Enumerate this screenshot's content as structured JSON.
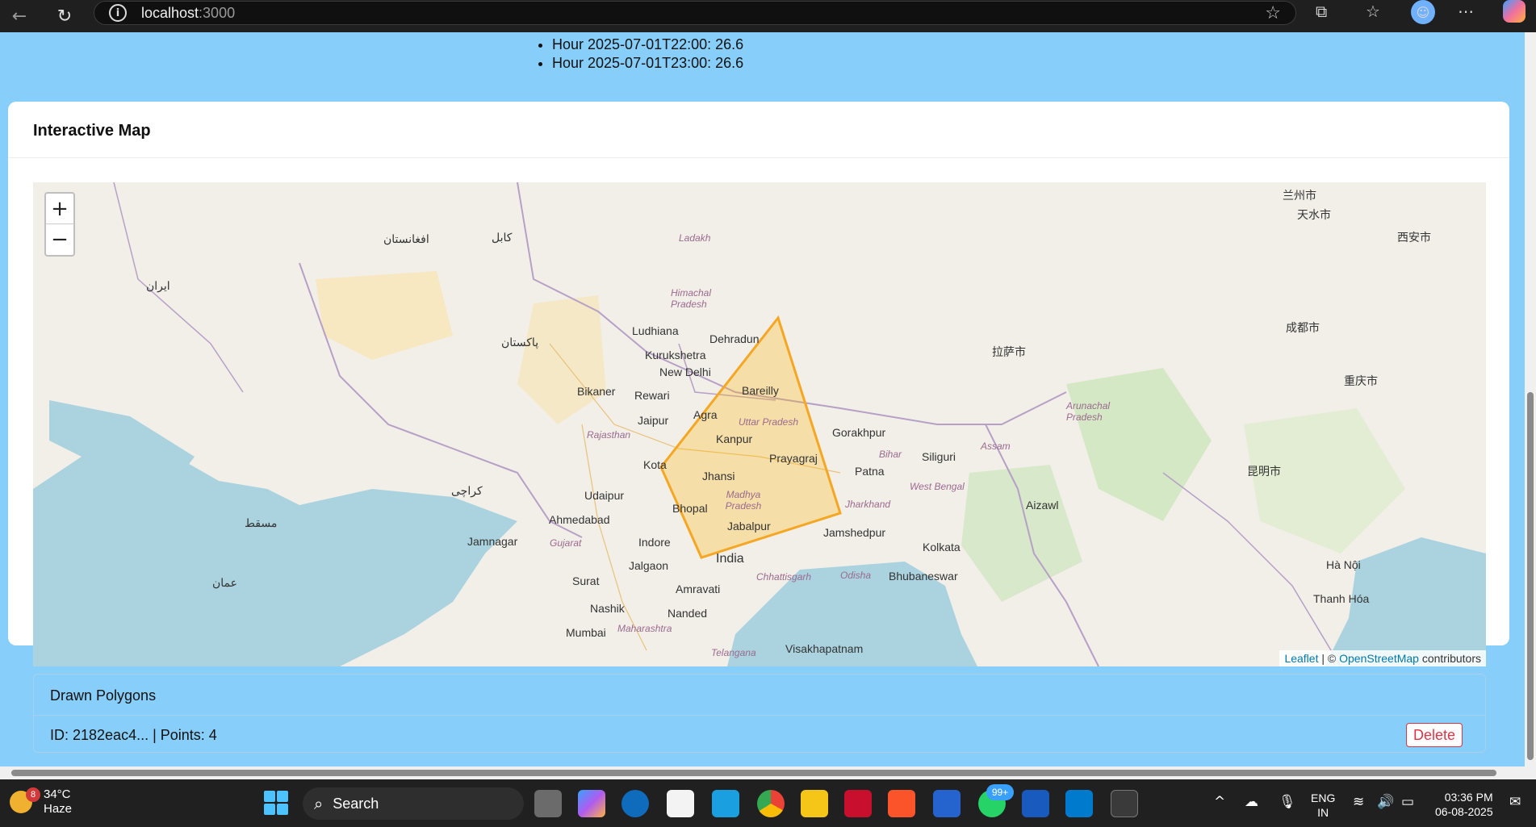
{
  "browser": {
    "back_icon": "arrow-left-icon",
    "refresh_icon": "refresh-icon",
    "url_host": "localhost",
    "url_port": ":3000"
  },
  "hourly": {
    "items": [
      "Hour 2025-07-01T22:00: 26.6",
      "Hour 2025-07-01T23:00: 26.6"
    ]
  },
  "map_card": {
    "title": "Interactive Map",
    "zoom_in": "+",
    "zoom_out": "−",
    "labels": {
      "kabul": "کابل",
      "afghanistan": "افغانستان",
      "iran": "ایران",
      "pakistan": "پاکستان",
      "ludhiana": "Ludhiana",
      "dehradun": "Dehradun",
      "kurukshetra": "Kurukshetra",
      "newdelhi": "New Delhi",
      "bikaner": "Bikaner",
      "rewari": "Rewari",
      "jaipur": "Jaipur",
      "agra": "Agra",
      "bareilly": "Bareilly",
      "kanpur": "Kanpur",
      "prayagraj": "Prayagraj",
      "jhansi": "Jhansi",
      "kota": "Kota",
      "udaipur": "Udaipur",
      "ahmedabad": "Ahmedabad",
      "bhopal": "Bhopal",
      "indore": "Indore",
      "jabalpur": "Jabalpur",
      "jamnagar": "Jamnagar",
      "jalgaon": "Jalgaon",
      "surat": "Surat",
      "amravati": "Amravati",
      "nashik": "Nashik",
      "nanded": "Nanded",
      "mumbai": "Mumbai",
      "india": "India",
      "gorakhpur": "Gorakhpur",
      "patna": "Patna",
      "siliguri": "Siliguri",
      "jamshedpur": "Jamshedpur",
      "kolkata": "Kolkata",
      "bhubaneswar": "Bhubaneswar",
      "visakhapatnam": "Visakhapatnam",
      "aizawl": "Aizawl",
      "hanoi": "Hà Nội",
      "thanhhoa": "Thanh Hóa",
      "rajasthan": "Rajasthan",
      "uttarpradesh": "Uttar Pradesh",
      "madhyapradesh": "Madhya Pradesh",
      "bihar": "Bihar",
      "jharkhand": "Jharkhand",
      "westbengal": "West Bengal",
      "gujarat": "Gujarat",
      "maharashtra": "Maharashtra",
      "chhattisgarh": "Chhattisgarh",
      "odisha": "Odisha",
      "telangana": "Telangana",
      "himachal": "Himachal Pradesh",
      "ladakh": "Ladakh",
      "assam": "Assam",
      "arunachal": "Arunachal Pradesh",
      "lanzhou": "兰州市",
      "tianshui": "天水市",
      "xian": "西安市",
      "chengdu": "成都市",
      "chongqing": "重庆市",
      "kunming": "昆明市",
      "lhasa": "拉萨市",
      "oman": "عمان",
      "muscat": "مسقط",
      "karachi": "کراچی"
    },
    "attribution": {
      "leaflet": "Leaflet",
      "sep": " | © ",
      "osm": "OpenStreetMap",
      "rest": " contributors"
    }
  },
  "polygons": {
    "heading": "Drawn Polygons",
    "row_text": "ID: 2182eac4... | Points: 4",
    "delete_label": "Delete"
  },
  "taskbar": {
    "temp": "34°C",
    "condition": "Haze",
    "weather_badge": "8",
    "search_label": "Search",
    "whatsapp_badge": "99+",
    "lang_line1": "ENG",
    "lang_line2": "IN",
    "time": "03:36 PM",
    "date": "06-08-2025"
  }
}
